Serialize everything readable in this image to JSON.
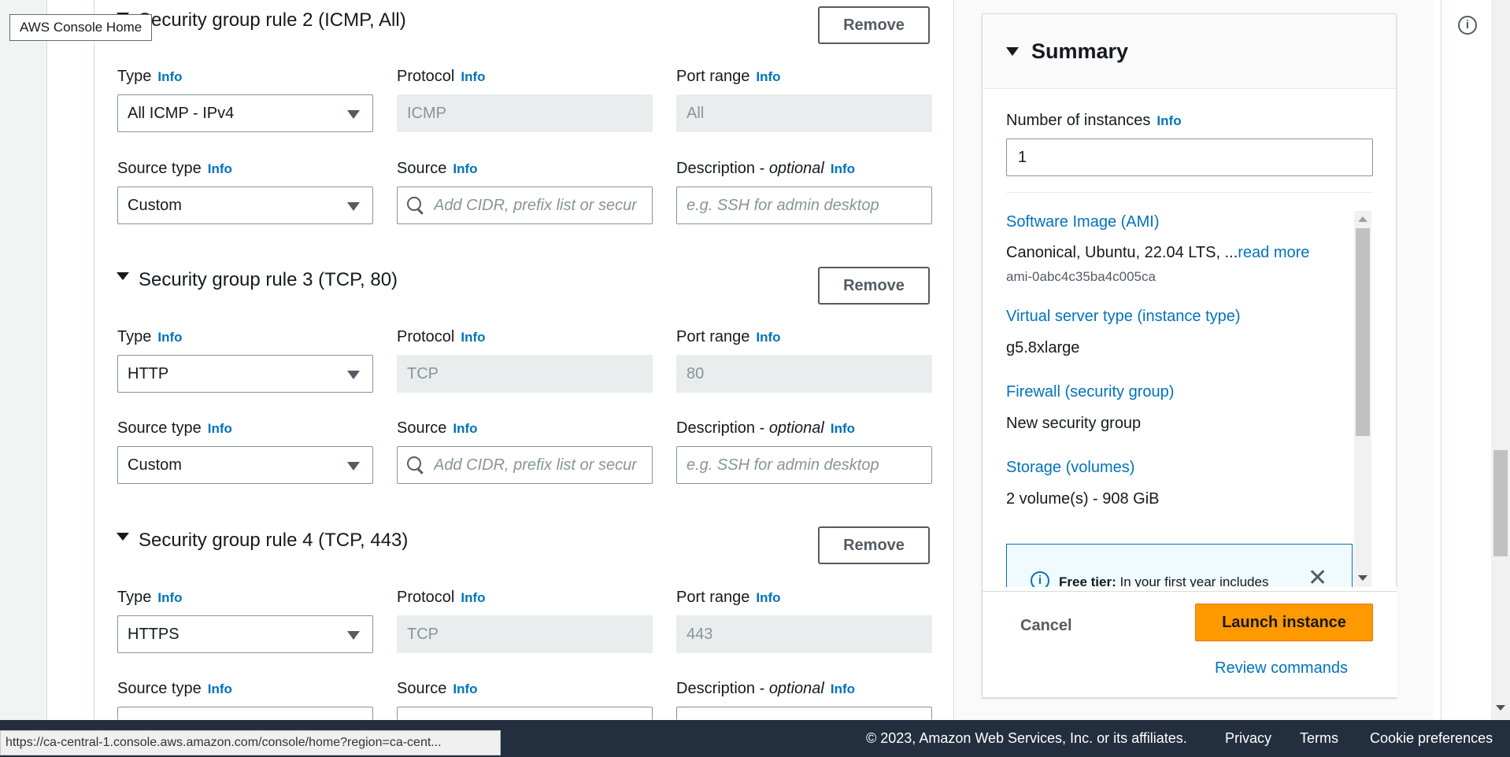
{
  "tooltip": "AWS Console Home",
  "rules": [
    {
      "title": "Security group rule 2 (ICMP, All)",
      "remove": "Remove",
      "type_label": "Type",
      "type_value": "All ICMP - IPv4",
      "protocol_label": "Protocol",
      "protocol_value": "ICMP",
      "port_label": "Port range",
      "port_value": "All",
      "source_type_label": "Source type",
      "source_type_value": "Custom",
      "source_label": "Source",
      "source_placeholder": "Add CIDR, prefix list or secur",
      "desc_label": "Description - ",
      "desc_optional": "optional",
      "desc_placeholder": "e.g. SSH for admin desktop"
    },
    {
      "title": "Security group rule 3 (TCP, 80)",
      "remove": "Remove",
      "type_label": "Type",
      "type_value": "HTTP",
      "protocol_label": "Protocol",
      "protocol_value": "TCP",
      "port_label": "Port range",
      "port_value": "80",
      "source_type_label": "Source type",
      "source_type_value": "Custom",
      "source_label": "Source",
      "source_placeholder": "Add CIDR, prefix list or secur",
      "desc_label": "Description - ",
      "desc_optional": "optional",
      "desc_placeholder": "e.g. SSH for admin desktop"
    },
    {
      "title": "Security group rule 4 (TCP, 443)",
      "remove": "Remove",
      "type_label": "Type",
      "type_value": "HTTPS",
      "protocol_label": "Protocol",
      "protocol_value": "TCP",
      "port_label": "Port range",
      "port_value": "443",
      "source_type_label": "Source type",
      "source_label": "Source",
      "desc_label": "Description - ",
      "desc_optional": "optional"
    }
  ],
  "info": "Info",
  "summary": {
    "title": "Summary",
    "num_instances_label": "Number of instances",
    "num_instances_value": "1",
    "ami_link": "Software Image (AMI)",
    "ami_value": "Canonical, Ubuntu, 22.04 LTS, ...",
    "read_more": "read more",
    "ami_id": "ami-0abc4c35ba4c005ca",
    "instance_type_link": "Virtual server type (instance type)",
    "instance_type_value": "g5.8xlarge",
    "firewall_link": "Firewall (security group)",
    "firewall_value": "New security group",
    "storage_link": "Storage (volumes)",
    "storage_value": "2 volume(s) - 908 GiB",
    "free_tier_bold": "Free tier:",
    "free_tier_text": " In your first year includes",
    "cancel": "Cancel",
    "launch": "Launch instance",
    "review": "Review commands"
  },
  "footer": {
    "copyright": "© 2023, Amazon Web Services, Inc. or its affiliates.",
    "privacy": "Privacy",
    "terms": "Terms",
    "cookies": "Cookie preferences"
  },
  "status_url": "https://ca-central-1.console.aws.amazon.com/console/home?region=ca-cent...",
  "colors": {
    "link": "#0073bb",
    "primary_button": "#ff9900",
    "footer_bg": "#232f3e"
  }
}
